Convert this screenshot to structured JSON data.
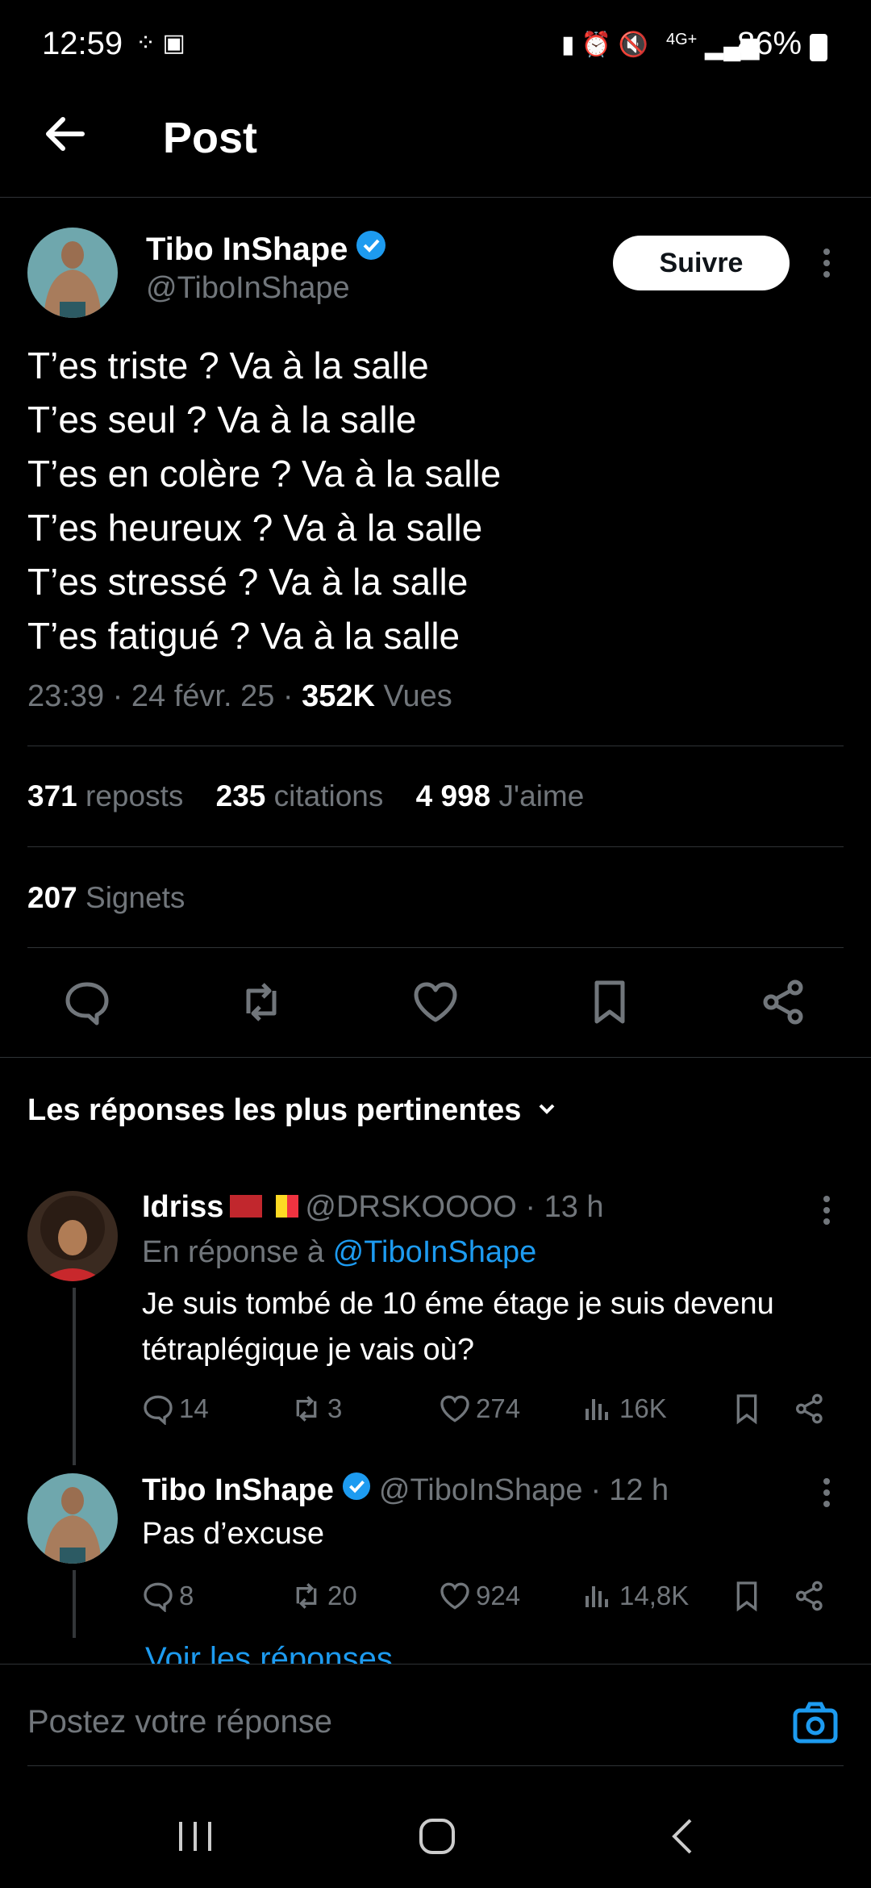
{
  "status_bar": {
    "time": "12:59",
    "battery": "86%",
    "network": "4G+"
  },
  "header": {
    "title": "Post"
  },
  "post": {
    "author_name": "Tibo InShape",
    "handle": "@TiboInShape",
    "follow_label": "Suivre",
    "text": "T’es triste ? Va à la salle\nT’es seul ? Va à la salle\nT’es en colère ? Va à la salle\nT’es heureux ? Va à la salle\nT’es stressé ? Va à la salle\nT’es fatigué ? Va à la salle",
    "time": "23:39",
    "date": "24 févr. 25",
    "views_count": "352K",
    "views_label": "Vues",
    "reposts_count": "371",
    "reposts_label": "reposts",
    "quotes_count": "235",
    "quotes_label": "citations",
    "likes_count": "4 998",
    "likes_label": "J'aime",
    "bookmarks_count": "207",
    "bookmarks_label": "Signets"
  },
  "replies_sort_label": "Les réponses les plus pertinentes",
  "replies": [
    {
      "name": "Idriss",
      "handle": "@DRSKOOOO",
      "time": "13 h",
      "reply_to_prefix": "En réponse à",
      "reply_to": "@TiboInShape",
      "text": "Je suis tombé de 10 éme étage je suis devenu tétraplégique je vais où?",
      "comments": "14",
      "reposts": "3",
      "likes": "274",
      "views": "16K"
    },
    {
      "name": "Tibo InShape",
      "handle": "@TiboInShape",
      "time": "12 h",
      "text": "Pas d’excuse",
      "comments": "8",
      "reposts": "20",
      "likes": "924",
      "views": "14,8K"
    }
  ],
  "see_replies": "Voir les réponses",
  "reply_placeholder": "Postez votre réponse",
  "colors": {
    "accent": "#1d9bf0",
    "background": "#000000",
    "muted": "#71767b"
  }
}
